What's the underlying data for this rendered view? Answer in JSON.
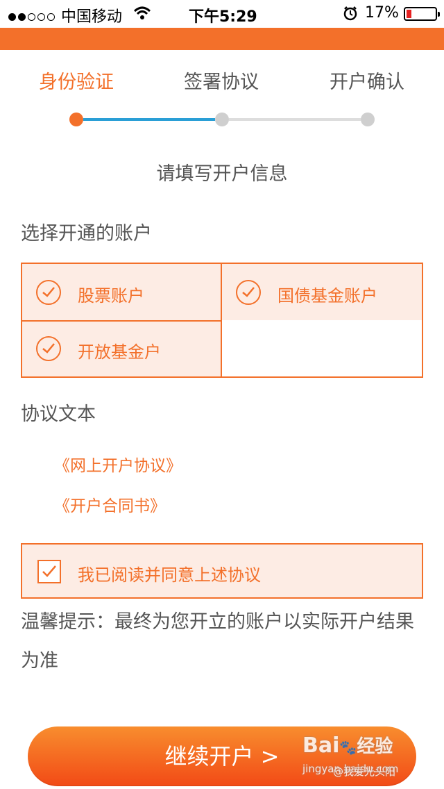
{
  "status_bar": {
    "carrier": "中国移动",
    "time": "下午5:29",
    "battery": "17%"
  },
  "steps": [
    {
      "label": "身份验证"
    },
    {
      "label": "签署协议"
    },
    {
      "label": "开户确认"
    }
  ],
  "form_title": "请填写开户信息",
  "accounts": {
    "section_label": "选择开通的账户",
    "items": [
      {
        "label": "股票账户"
      },
      {
        "label": "国债基金账户"
      },
      {
        "label": "开放基金户"
      }
    ]
  },
  "agreements": {
    "section_label": "协议文本",
    "links": [
      "《网上开户协议》",
      "《开户合同书》"
    ],
    "agree_label": "我已阅读并同意上述协议"
  },
  "tip": "温馨提示：最终为您开立的账户以实际开户结果为准",
  "continue_label": "继续开户 >",
  "watermark": {
    "brand": "Bai",
    "text": "经验",
    "site": "jingyan.baidu.com",
    "author": "@我爱光头阳"
  },
  "colors": {
    "accent": "#f3702a",
    "progress_line": "#2a9fd6"
  }
}
